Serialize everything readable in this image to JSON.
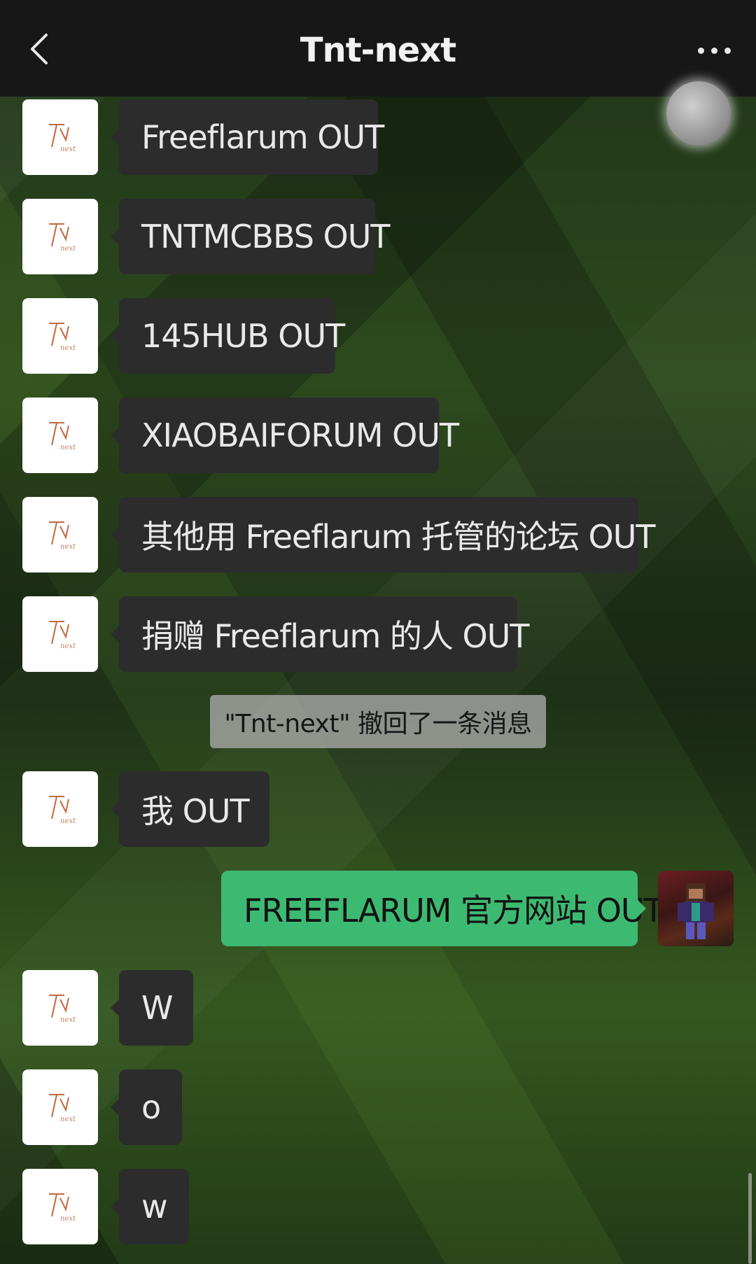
{
  "header": {
    "title": "Tnt-next",
    "back_icon": "chevron-left-icon",
    "more_icon": "ellipsis-icon"
  },
  "colors": {
    "topbar": "#171717",
    "bubble_other": "#2c2c2c",
    "bubble_mine": "#3dba72",
    "system_tip": "#aaaaaa"
  },
  "messages": [
    {
      "sender": "Tnt-next",
      "text": "Freeflarum OUT"
    },
    {
      "sender": "Tnt-next",
      "text": "TNTMCBBS OUT"
    },
    {
      "sender": "Tnt-next",
      "text": "145HUB OUT"
    },
    {
      "sender": "Tnt-next",
      "text": "XIAOBAIFORUM OUT"
    },
    {
      "sender": "Tnt-next",
      "text": "其他用 Freeflarum 托管的论坛 OUT"
    },
    {
      "sender": "Tnt-next",
      "text": "捐赠 Freeflarum 的人 OUT"
    },
    {
      "sender": "Tnt-next",
      "text": "我 OUT"
    },
    {
      "sender": "me",
      "text": "FREEFLARUM 官方网站 OUT"
    },
    {
      "sender": "Tnt-next",
      "text": "W"
    },
    {
      "sender": "Tnt-next",
      "text": "o"
    },
    {
      "sender": "Tnt-next",
      "text": "w"
    }
  ],
  "system_notice": "\"Tnt-next\" 撤回了一条消息"
}
